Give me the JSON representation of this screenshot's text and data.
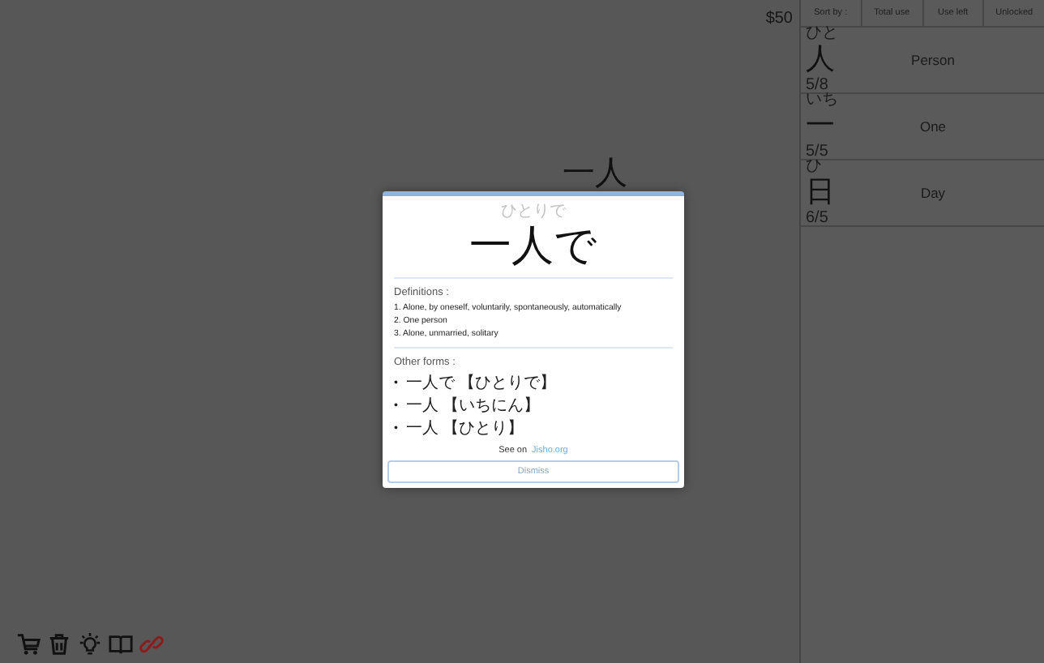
{
  "money": "$50",
  "current_word": "一人",
  "modal": {
    "reading": "ひとりで",
    "word": "一人で",
    "definitions_title": "Definitions :",
    "definitions": [
      "1. Alone, by oneself, voluntarily, spontaneously, automatically",
      "2. One person",
      "3. Alone, unmarried, solitary"
    ],
    "other_forms_title": "Other forms :",
    "other_forms": [
      {
        "marker": "•",
        "text": "一人で 【ひとりで】"
      },
      {
        "marker": "•",
        "text": "一人 【いちにん】"
      },
      {
        "marker": "•",
        "text": "一人 【ひとり】"
      }
    ],
    "see_on": "See on",
    "link": "Jisho.org",
    "dismiss": "Dismiss"
  },
  "sort": {
    "label": "Sort by :",
    "options": [
      "Total use",
      "Use left",
      "Unlocked"
    ]
  },
  "kanji": [
    {
      "reading": "ひと",
      "kanji": "人",
      "meaning": "Person",
      "count": "5/8"
    },
    {
      "reading": "いち",
      "kanji": "一",
      "meaning": "One",
      "count": "5/5"
    },
    {
      "reading": "ひ",
      "kanji": "日",
      "meaning": "Day",
      "count": "6/5"
    }
  ]
}
